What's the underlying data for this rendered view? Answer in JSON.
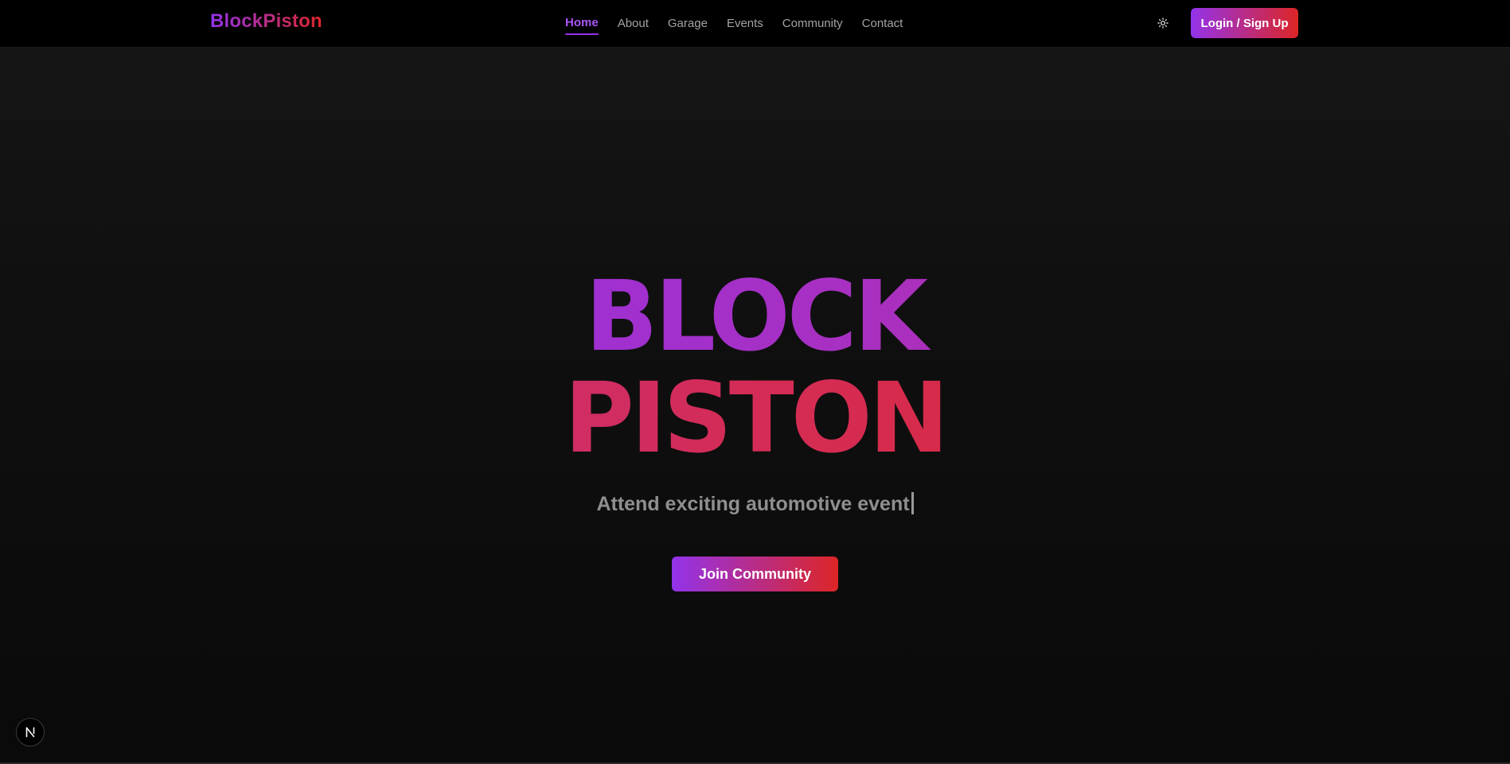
{
  "header": {
    "brand": "BlockPiston",
    "nav": [
      {
        "label": "Home",
        "active": true
      },
      {
        "label": "About",
        "active": false
      },
      {
        "label": "Garage",
        "active": false
      },
      {
        "label": "Events",
        "active": false
      },
      {
        "label": "Community",
        "active": false
      },
      {
        "label": "Contact",
        "active": false
      }
    ],
    "theme_toggle_icon": "sun-icon",
    "login_label": "Login / Sign Up"
  },
  "hero": {
    "title_line1": "BLOCK",
    "title_line2": "PISTON",
    "subtitle": "Attend exciting automotive event",
    "cta_label": "Join Community"
  },
  "badge": {
    "letter": "N",
    "icon": "nextjs-badge-icon"
  },
  "colors": {
    "accent_start": "#9333ea",
    "accent_end": "#dc2626",
    "nav_active": "#a855f7",
    "background": "#0a0a0a"
  }
}
